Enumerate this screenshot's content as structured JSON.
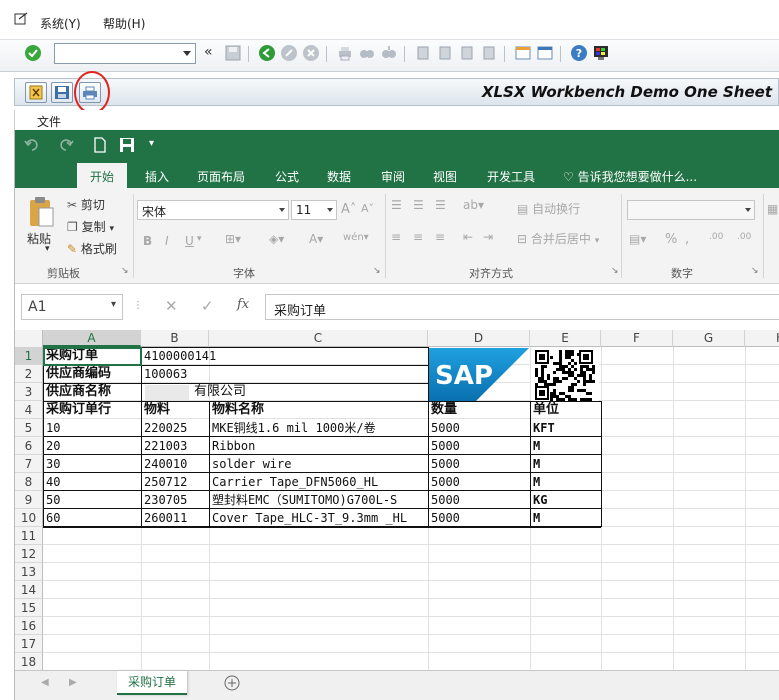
{
  "sap": {
    "menu": [
      {
        "label": "系统(Y)"
      },
      {
        "label": "帮助(H)"
      }
    ],
    "command_field": "",
    "app_title": "XLSX Workbench Demo One Sheet",
    "file_menu": "文件"
  },
  "excel": {
    "tabs": [
      "开始",
      "插入",
      "页面布局",
      "公式",
      "数据",
      "审阅",
      "视图",
      "开发工具"
    ],
    "tell_me": "告诉我您想要做什么...",
    "ribbon": {
      "clipboard": {
        "paste": "粘贴",
        "cut": "剪切",
        "copy": "复制",
        "format_painter": "格式刷",
        "label": "剪贴板"
      },
      "font": {
        "name": "宋体",
        "size": "11",
        "label": "字体"
      },
      "alignment": {
        "wrap": "自动换行",
        "merge": "合并后居中",
        "label": "对齐方式"
      },
      "number": {
        "label": "数字",
        "format": ""
      }
    },
    "name_box": "A1",
    "formula": "采购订单",
    "columns": [
      "A",
      "B",
      "C",
      "D",
      "E",
      "F",
      "G",
      "H"
    ],
    "rows": [
      "1",
      "2",
      "3",
      "4",
      "5",
      "6",
      "7",
      "8",
      "9",
      "10",
      "11",
      "12",
      "13",
      "14",
      "15",
      "16",
      "17",
      "18"
    ],
    "sheet_tab": "采购订单"
  },
  "sheet": {
    "header": [
      {
        "label": "采购订单",
        "value": "4100000141"
      },
      {
        "label": "供应商编码",
        "value": "100063"
      },
      {
        "label": "供应商名称",
        "value": "有限公司"
      }
    ],
    "logo_text": "SAP",
    "table_header": [
      "采购订单行",
      "物料",
      "物料名称",
      "数量",
      "单位"
    ],
    "lines": [
      [
        "10",
        "220025",
        "MKE铜线1.6 mil 1000米/卷",
        "5000",
        "KFT"
      ],
      [
        "20",
        "221003",
        "Ribbon",
        "5000",
        "M"
      ],
      [
        "30",
        "240010",
        "solder wire",
        "5000",
        "M"
      ],
      [
        "40",
        "250712",
        "Carrier Tape_DFN5060_HL",
        "5000",
        "M"
      ],
      [
        "50",
        "230705",
        "塑封料EMC（SUMITOMO)G700L-S",
        "5000",
        "KG"
      ],
      [
        "60",
        "260011",
        "Cover Tape_HLC-3T_9.3mm _HL",
        "5000",
        "M"
      ]
    ]
  },
  "colors": {
    "excel_green": "#217346",
    "sap_highlight": "#e0231c",
    "sap_blue": "#0a7bbf"
  }
}
